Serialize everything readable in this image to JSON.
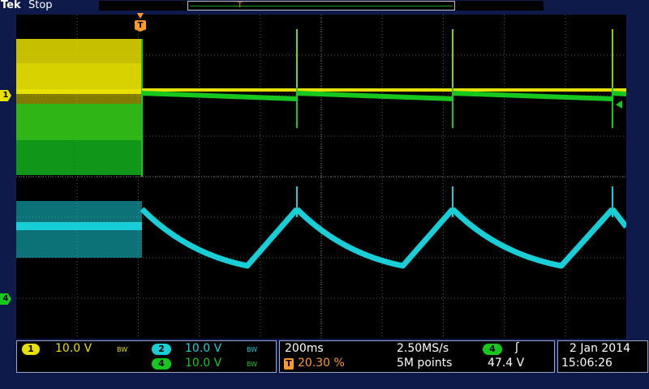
{
  "header": {
    "brand": "Tek",
    "run_state": "Stop"
  },
  "markers": {
    "ch1": "1",
    "ch4": "4",
    "trigger": "T"
  },
  "channels": [
    {
      "id": "1",
      "scale": "10.0 V",
      "bandwidth": "BW",
      "color": "#e8e000"
    },
    {
      "id": "2",
      "scale": "10.0 V",
      "bandwidth": "BW",
      "color": "#18cfd8"
    },
    {
      "id": "4",
      "scale": "10.0 V",
      "bandwidth": "BW",
      "color": "#16c81e"
    }
  ],
  "timebase": {
    "scale": "200ms",
    "sample_rate": "2.50MS/s",
    "trigger_position_icon": "T",
    "trigger_position": "20.30 %",
    "record_length": "5M points"
  },
  "trigger": {
    "source": "4",
    "slope_icon": "rising-edge-icon",
    "slope_glyph": "ʃ",
    "level": "47.4 V"
  },
  "datetime": {
    "date": "2 Jan  2014",
    "time": "15:06:26"
  },
  "colors": {
    "background": "#0d1a4a",
    "ch1": "#e8e000",
    "ch2": "#18cfd8",
    "ch4": "#16c81e",
    "trigger": "#ff9a2a"
  }
}
